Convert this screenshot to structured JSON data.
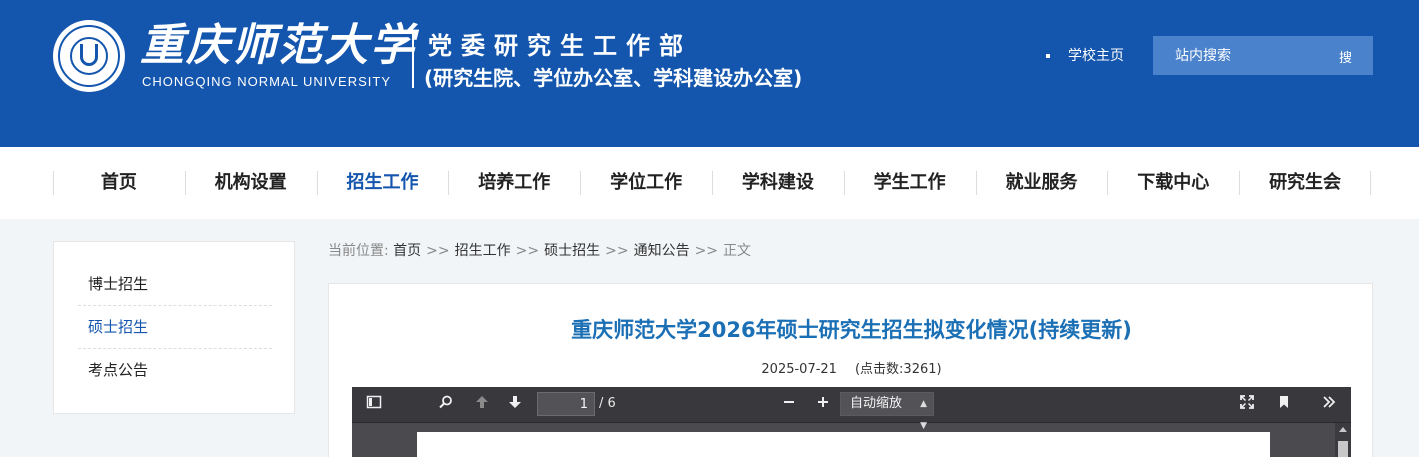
{
  "header": {
    "univ_name_cn": "重庆师范大学",
    "univ_name_en": "CHONGQING NORMAL UNIVERSITY",
    "dept_title": "党委研究生工作部",
    "dept_subtitle": "(研究生院、学位办公室、学科建设办公室)",
    "home_link": "学校主页",
    "search_placeholder": "站内搜索",
    "search_button": "搜"
  },
  "nav": {
    "items": [
      "首页",
      "机构设置",
      "招生工作",
      "培养工作",
      "学位工作",
      "学科建设",
      "学生工作",
      "就业服务",
      "下载中心",
      "研究生会"
    ],
    "active": "招生工作"
  },
  "sidebar": {
    "items": [
      "博士招生",
      "硕士招生",
      "考点公告"
    ],
    "active": "硕士招生"
  },
  "breadcrumb": {
    "label": "当前位置:",
    "items": [
      "首页",
      "招生工作",
      "硕士招生",
      "通知公告"
    ],
    "separator": ">>",
    "current": "正文"
  },
  "article": {
    "title": "重庆师范大学2026年硕士研究生招生拟变化情况(持续更新)",
    "date": "2025-07-21",
    "views": "(点击数:3261)"
  },
  "pdf_viewer": {
    "current_page": "1",
    "total_pages": "/ 6",
    "zoom": "自动缩放",
    "icons": [
      "sidebar-toggle-icon",
      "search-icon",
      "arrow-up-icon",
      "arrow-down-icon",
      "minus-icon",
      "plus-icon",
      "fullscreen-icon",
      "bookmark-icon",
      "double-chevron-right-icon"
    ]
  },
  "colors": {
    "brand_blue": "#1456ad",
    "title_blue": "#1a6fb5",
    "toolbar_dark": "#38383d"
  }
}
